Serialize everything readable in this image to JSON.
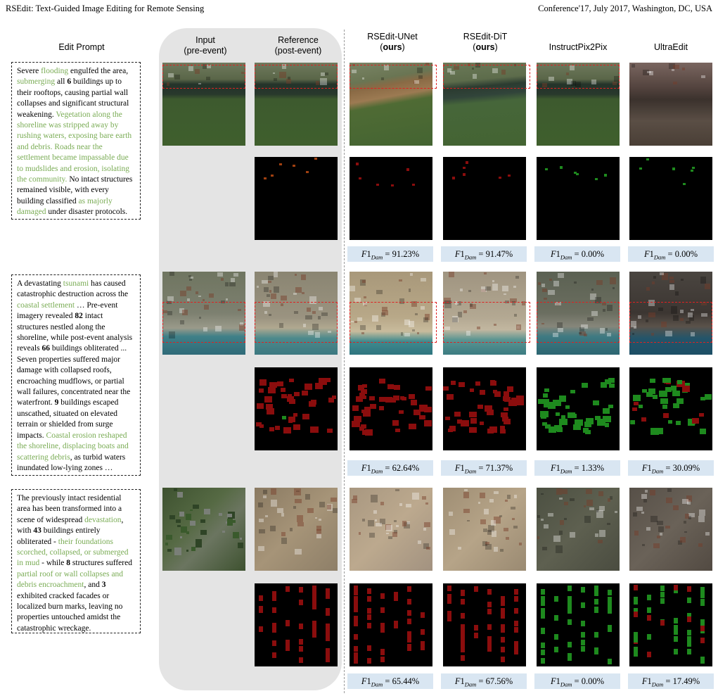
{
  "header": {
    "left": "RSEdit: Text-Guided Image Editing for Remote Sensing",
    "right": "Conference'17, July 2017, Washington, DC, USA"
  },
  "columns": {
    "prompt": "Edit Prompt",
    "input": "Input",
    "input_sub": "(pre-event)",
    "reference": "Reference",
    "reference_sub": "(post-event)",
    "unet": "RSEdit-UNet",
    "unet_sub": "ours",
    "dit": "RSEdit-DiT",
    "dit_sub": "ours",
    "ip2p": "InstructPix2Pix",
    "ultra": "UltraEdit"
  },
  "rows": [
    {
      "prompt_parts": [
        {
          "t": "Severe ",
          "c": "n"
        },
        {
          "t": "flooding",
          "c": "g"
        },
        {
          "t": " engulfed the area, ",
          "c": "n"
        },
        {
          "t": "submerging",
          "c": "g"
        },
        {
          "t": " all ",
          "c": "n"
        },
        {
          "t": "6",
          "c": "b"
        },
        {
          "t": " buildings up to their rooftops, causing partial wall collapses and significant structural weakening. ",
          "c": "n"
        },
        {
          "t": "Vegetation along the shoreline was stripped away by rushing waters, exposing bare earth and debris. Roads near the settlement became impassable due to mudslides and erosion, isolating the community.",
          "c": "g"
        },
        {
          "t": " No intact structures remained visible, with every building classified ",
          "c": "n"
        },
        {
          "t": "as majorly damaged",
          "c": "g"
        },
        {
          "t": " under disaster protocols.",
          "c": "n"
        }
      ],
      "f1": {
        "unet": "91.23%",
        "dit": "91.47%",
        "ip2p": "0.00%",
        "ultra": "0.00%"
      }
    },
    {
      "prompt_parts": [
        {
          "t": "A devastating ",
          "c": "n"
        },
        {
          "t": "tsunami",
          "c": "g"
        },
        {
          "t": " has caused catastrophic destruction across the ",
          "c": "n"
        },
        {
          "t": "coastal settlement",
          "c": "g"
        },
        {
          "t": " … Pre-event imagery revealed ",
          "c": "n"
        },
        {
          "t": "82",
          "c": "b"
        },
        {
          "t": " intact structures nestled along the shoreline, while post-event analysis reveals ",
          "c": "n"
        },
        {
          "t": "66",
          "c": "b"
        },
        {
          "t": " buildings obliterated ... Seven properties suffered major damage with collapsed roofs, encroaching mudflows, or partial wall failures, concentrated near the waterfront. ",
          "c": "n"
        },
        {
          "t": "9",
          "c": "b"
        },
        {
          "t": " buildings escaped unscathed, situated on elevated terrain or shielded from surge impacts. ",
          "c": "n"
        },
        {
          "t": "Coastal erosion reshaped the shoreline, displacing boats and scattering debris",
          "c": "g"
        },
        {
          "t": ", as turbid waters inundated low-lying zones …",
          "c": "n"
        }
      ],
      "f1": {
        "unet": "62.64%",
        "dit": "71.37%",
        "ip2p": "1.33%",
        "ultra": "30.09%"
      }
    },
    {
      "prompt_parts": [
        {
          "t": "The previously intact residential area has been transformed into a scene of widespread ",
          "c": "n"
        },
        {
          "t": "devastation",
          "c": "g"
        },
        {
          "t": ", with ",
          "c": "n"
        },
        {
          "t": "43",
          "c": "b"
        },
        {
          "t": " buildings entirely obliterated - ",
          "c": "n"
        },
        {
          "t": "their foundations scorched, collapsed, or submerged in mud",
          "c": "g"
        },
        {
          "t": " - while ",
          "c": "n"
        },
        {
          "t": "8",
          "c": "b"
        },
        {
          "t": " structures suffered ",
          "c": "n"
        },
        {
          "t": "partial roof or wall collapses and debris encroachment",
          "c": "g"
        },
        {
          "t": ", and ",
          "c": "n"
        },
        {
          "t": "3",
          "c": "b"
        },
        {
          "t": " exhibited cracked facades or localized burn marks, leaving no properties untouched amidst the catastrophic wreckage.",
          "c": "n"
        }
      ],
      "f1": {
        "unet": "65.44%",
        "dit": "67.56%",
        "ip2p": "0.00%",
        "ultra": "17.49%"
      }
    }
  ],
  "f1_symbol": "F1",
  "f1_subscript": "Dam",
  "colors": {
    "damage": "#8b0d0d",
    "intact": "#1e8a1e",
    "minor": "#a04010",
    "dashed_box": "#e02020",
    "score_bg": "#d9e6f2",
    "green_text": "#7aac55"
  }
}
